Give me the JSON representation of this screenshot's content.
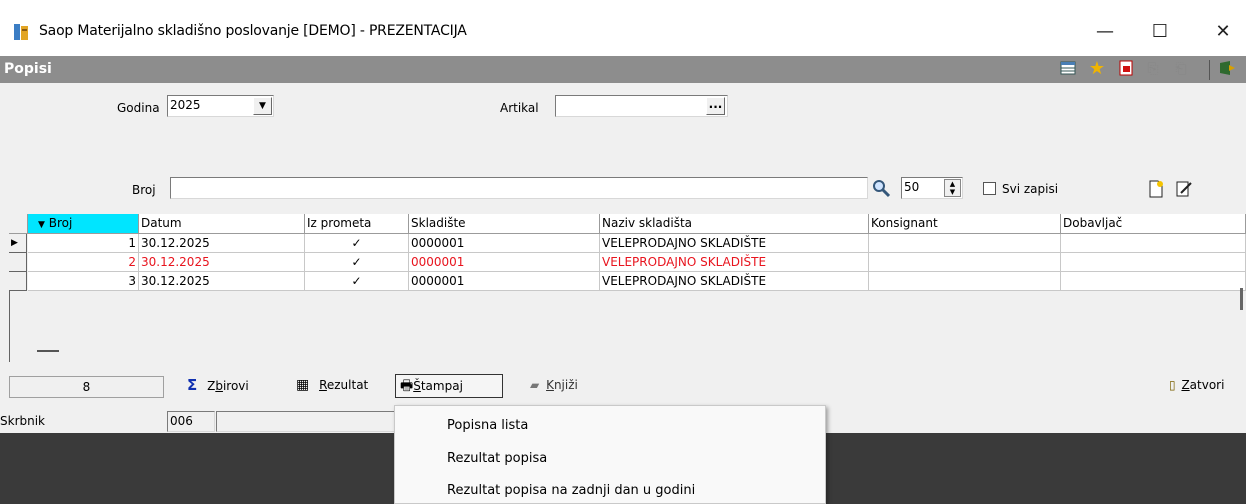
{
  "window": {
    "title": "Saop Materijalno skladišno poslovanje [DEMO] - PREZENTACIJA",
    "minimize": "—",
    "maximize": "☐",
    "close": "✕"
  },
  "form": {
    "title": "Popisi",
    "toolbar_icons": [
      "table-settings-icon",
      "star-icon",
      "pdf-icon",
      "copy-icon",
      "paste-icon",
      "exit-icon"
    ]
  },
  "filters": {
    "godina_label": "Godina",
    "godina_value": "2025",
    "artikal_label": "Artikal",
    "artikal_value": "",
    "artikal_btn": "...",
    "broj_label": "Broj",
    "broj_value": "",
    "page_size": "50",
    "svi_zapisi_label": "Svi zapisi"
  },
  "table": {
    "columns": [
      "Broj",
      "Datum",
      "Iz prometa",
      "Skladište",
      "Naziv skladišta",
      "Konsignant",
      "Dobavljač"
    ],
    "rows": [
      {
        "broj": "1",
        "datum": "30.12.2025",
        "iz_prometa": "✓",
        "skladiste": "0000001",
        "naziv": "VELEPRODAJNO SKLADIŠTE",
        "konsignant": "",
        "dobavljac": "",
        "highlight": false
      },
      {
        "broj": "2",
        "datum": "30.12.2025",
        "iz_prometa": "✓",
        "skladiste": "0000001",
        "naziv": "VELEPRODAJNO SKLADIŠTE",
        "konsignant": "",
        "dobavljac": "",
        "highlight": true
      },
      {
        "broj": "3",
        "datum": "30.12.2025",
        "iz_prometa": "✓",
        "skladiste": "0000001",
        "naziv": "VELEPRODAJNO SKLADIŠTE",
        "konsignant": "",
        "dobavljac": "",
        "highlight": false
      }
    ],
    "highlight_color": "#e8141e",
    "sort_header_color": "#00e5ff"
  },
  "bottom": {
    "count": "8",
    "zbirovi_pre": "Z",
    "zbirovi_u": "b",
    "zbirovi_post": "irovi",
    "rezultat_u": "R",
    "rezultat_post": "ezultat",
    "stampaj_u": "Š",
    "stampaj_post": "tampaj",
    "knjizi_u": "K",
    "knjizi_post": "njiži",
    "zatvori_u": "Z",
    "zatvori_post": "atvori"
  },
  "status": {
    "label": "Skrbnik",
    "value": "006"
  },
  "print_menu": {
    "items": [
      "Popisna lista",
      "Rezultat popisa",
      "Rezultat popisa na zadnji dan u godini"
    ]
  }
}
